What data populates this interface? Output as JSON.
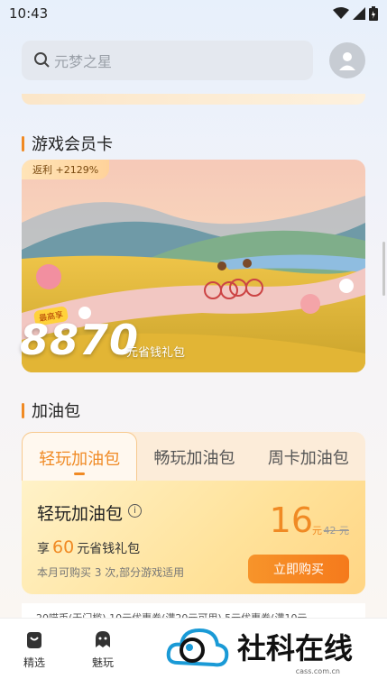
{
  "status": {
    "time": "10:43"
  },
  "search": {
    "placeholder": "元梦之星"
  },
  "sections": {
    "member_title": "游戏会员卡",
    "pack_title": "加油包"
  },
  "member_card": {
    "rebate": "返利 +2129%",
    "best_tag": "最高享",
    "amount": "8870",
    "unit": "元省钱礼包"
  },
  "tabs": [
    {
      "label": "轻玩加油包",
      "active": true
    },
    {
      "label": "畅玩加油包",
      "active": false
    },
    {
      "label": "周卡加油包",
      "active": false
    }
  ],
  "pack": {
    "name": "轻玩加油包",
    "save_prefix": "享",
    "save_amount": "60",
    "save_suffix": "元省钱礼包",
    "limit_note": "本月可购买 3 次,部分游戏适用",
    "price": "16",
    "price_unit": "元",
    "old_price": "42 元",
    "buy_label": "立即购买"
  },
  "coupon_text": "20喵币(无门槛) 10元优惠券(满20元可用) 5元优惠券(满10元",
  "nav": [
    {
      "label": "精选",
      "icon": "bag-icon"
    },
    {
      "label": "魅玩",
      "icon": "ghost-icon"
    }
  ],
  "watermark": {
    "text": "社科在线",
    "sub": "cass.com.cn"
  },
  "colors": {
    "accent": "#f08a24",
    "buy_button": "#f57a1c"
  }
}
